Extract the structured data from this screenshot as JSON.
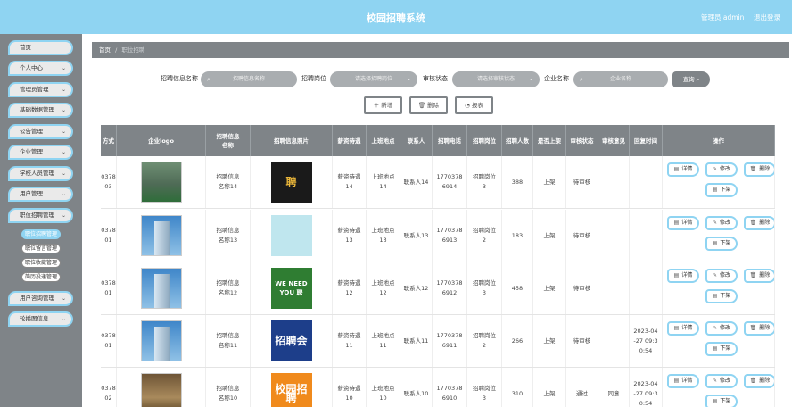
{
  "header": {
    "title": "校园招聘系统",
    "user": "管理员 admin",
    "logout": "退出登录"
  },
  "sidebar": {
    "items": [
      {
        "label": "首页"
      },
      {
        "label": "个人中心"
      },
      {
        "label": "管理员管理"
      },
      {
        "label": "基础数据管理"
      },
      {
        "label": "公告管理"
      },
      {
        "label": "企业管理"
      },
      {
        "label": "学校人员管理"
      },
      {
        "label": "用户管理"
      },
      {
        "label": "职位招聘管理"
      },
      {
        "label": "用户咨询管理"
      },
      {
        "label": "轮播图信息"
      }
    ],
    "sub_items": [
      {
        "label": "职位招聘管理"
      },
      {
        "label": "职位留言管理"
      },
      {
        "label": "职位收藏管理"
      },
      {
        "label": "简历投递管理"
      }
    ]
  },
  "breadcrumb": {
    "home": "首页",
    "sep": "/",
    "current": "职位招聘"
  },
  "search": {
    "name_label": "招聘信息名称",
    "name_placeholder": "招聘信息名称",
    "post_label": "招聘岗位",
    "post_placeholder": "请选择招聘岗位",
    "status_label": "审核状态",
    "status_placeholder": "请选择审核状态",
    "company_label": "企业名称",
    "company_placeholder": "企业名称",
    "query_btn": "查询"
  },
  "actions": {
    "add": "新增",
    "delete": "删除",
    "report": "报表"
  },
  "table": {
    "headers": [
      "方式",
      "企业logo",
      "招聘信息\n名称",
      "招聘信息照片",
      "薪资待遇",
      "上班地点",
      "联系人",
      "招聘电话",
      "招聘岗位",
      "招聘人数",
      "是否上架",
      "审核状态",
      "审核意见",
      "回复时间",
      "操作"
    ],
    "rows": [
      {
        "mode": "0378\n03",
        "name": "招聘信息\n名称14",
        "photo_text": "聘",
        "photo_color": "#1a1a1a",
        "photo_accent": "#e8b53a",
        "salary": "薪资待遇\n14",
        "place": "上班地点\n14",
        "contact": "联系人14",
        "phone": "1770378\n6914",
        "post": "招聘岗位\n3",
        "count": "388",
        "shelf": "上架",
        "audit": "待审核",
        "opinion": "",
        "reply": ""
      },
      {
        "mode": "0378\n01",
        "name": "招聘信息\n名称13",
        "photo_text": "",
        "photo_color": "#bfe6ee",
        "photo_accent": "#7cc6d6",
        "salary": "薪资待遇\n13",
        "place": "上班地点\n13",
        "contact": "联系人13",
        "phone": "1770378\n6913",
        "post": "招聘岗位\n2",
        "count": "183",
        "shelf": "上架",
        "audit": "待审核",
        "opinion": "",
        "reply": ""
      },
      {
        "mode": "0378\n01",
        "name": "招聘信息\n名称12",
        "photo_text": "WE NEED YOU 聘",
        "photo_color": "#2f7d32",
        "photo_accent": "#ffffff",
        "salary": "薪资待遇\n12",
        "place": "上班地点\n12",
        "contact": "联系人12",
        "phone": "1770378\n6912",
        "post": "招聘岗位\n3",
        "count": "458",
        "shelf": "上架",
        "audit": "待审核",
        "opinion": "",
        "reply": ""
      },
      {
        "mode": "0378\n01",
        "name": "招聘信息\n名称11",
        "photo_text": "招聘会",
        "photo_color": "#1d3e8a",
        "photo_accent": "#ffffff",
        "salary": "薪资待遇\n11",
        "place": "上班地点\n11",
        "contact": "联系人11",
        "phone": "1770378\n6911",
        "post": "招聘岗位\n2",
        "count": "266",
        "shelf": "上架",
        "audit": "待审核",
        "opinion": "",
        "reply": "2023-04\n-27 09:3\n0:54"
      },
      {
        "mode": "0378\n02",
        "name": "招聘信息\n名称10",
        "photo_text": "校园招聘",
        "photo_color": "#f08a1c",
        "photo_accent": "#ffffff",
        "salary": "薪资待遇\n10",
        "place": "上班地点\n10",
        "contact": "联系人10",
        "phone": "1770378\n6910",
        "post": "招聘岗位\n3",
        "count": "310",
        "shelf": "上架",
        "audit": "通过",
        "opinion": "同意",
        "reply": "2023-04\n-27 09:3\n0:54"
      }
    ],
    "ops": {
      "detail": "详情",
      "edit": "修改",
      "delete": "删除",
      "off": "下架"
    }
  },
  "colors": {
    "accent": "#8fd4f2",
    "gray": "#7f8488"
  }
}
